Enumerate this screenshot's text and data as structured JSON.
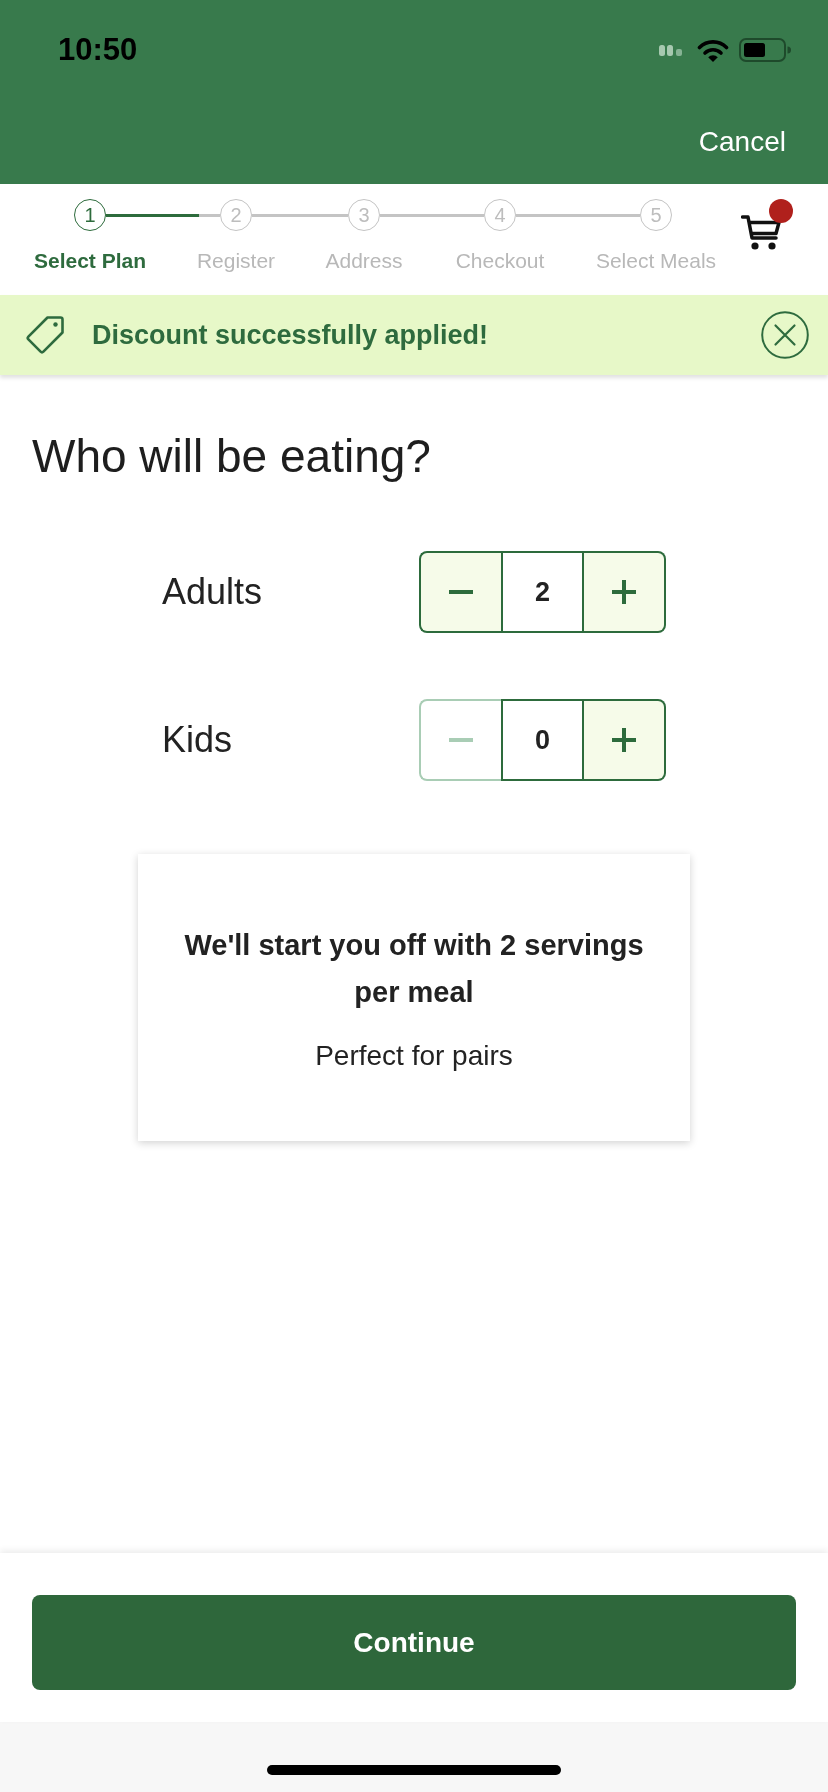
{
  "status_bar": {
    "time": "10:50"
  },
  "nav": {
    "cancel": "Cancel"
  },
  "steps": [
    {
      "number": "1",
      "label": "Select Plan",
      "selected": true
    },
    {
      "number": "2",
      "label": "Register",
      "selected": false
    },
    {
      "number": "3",
      "label": "Address",
      "selected": false
    },
    {
      "number": "4",
      "label": "Checkout",
      "selected": false
    },
    {
      "number": "5",
      "label": "Select Meals",
      "selected": false
    }
  ],
  "cart": {
    "notification": true
  },
  "banner": {
    "message": "Discount successfully applied!"
  },
  "heading": "Who will be eating?",
  "counters": [
    {
      "label": "Adults",
      "value": "2",
      "decrease_disabled": false
    },
    {
      "label": "Kids",
      "value": "0",
      "decrease_disabled": true
    }
  ],
  "summary": {
    "title": "We'll start you off with 2 servings per meal",
    "subtitle": "Perfect for pairs"
  },
  "continue_button": {
    "label": "Continue"
  }
}
